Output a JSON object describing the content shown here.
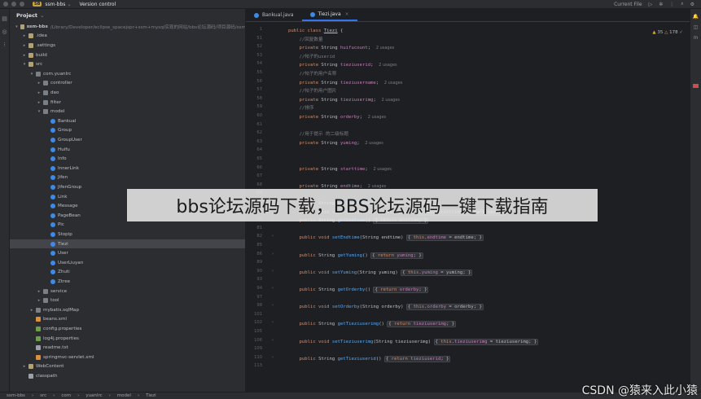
{
  "titlebar": {
    "project_badge": "SB",
    "project_name": "ssm-bbs",
    "vcs": "Version control",
    "run_config": "Current File"
  },
  "panel": {
    "title": "Project",
    "tree": [
      {
        "label": "ssm-bbs",
        "path": "/Library/Developer/eclipse_spacejspr+ssm+mysql实现的网站/bbs论坛源码/项目源码/ssm",
        "depth": 0,
        "arrow": "▾",
        "icon": "folder",
        "bold": true
      },
      {
        "label": ".idea",
        "depth": 1,
        "arrow": "▸",
        "icon": "folder"
      },
      {
        "label": ".settings",
        "depth": 1,
        "arrow": "▸",
        "icon": "folder"
      },
      {
        "label": "build",
        "depth": 1,
        "arrow": "▸",
        "icon": "folder"
      },
      {
        "label": "src",
        "depth": 1,
        "arrow": "▾",
        "icon": "folder"
      },
      {
        "label": "com.yuanlrc",
        "depth": 2,
        "arrow": "▾",
        "icon": "pkg"
      },
      {
        "label": "controller",
        "depth": 3,
        "arrow": "▸",
        "icon": "pkg"
      },
      {
        "label": "dao",
        "depth": 3,
        "arrow": "▸",
        "icon": "pkg"
      },
      {
        "label": "filter",
        "depth": 3,
        "arrow": "▸",
        "icon": "pkg"
      },
      {
        "label": "model",
        "depth": 3,
        "arrow": "▾",
        "icon": "pkg"
      },
      {
        "label": "Bankual",
        "depth": 4,
        "arrow": "",
        "icon": "cls"
      },
      {
        "label": "Group",
        "depth": 4,
        "arrow": "",
        "icon": "cls"
      },
      {
        "label": "GroupUser",
        "depth": 4,
        "arrow": "",
        "icon": "cls"
      },
      {
        "label": "Huifu",
        "depth": 4,
        "arrow": "",
        "icon": "cls"
      },
      {
        "label": "Info",
        "depth": 4,
        "arrow": "",
        "icon": "cls"
      },
      {
        "label": "InnerLink",
        "depth": 4,
        "arrow": "",
        "icon": "cls"
      },
      {
        "label": "Jifen",
        "depth": 4,
        "arrow": "",
        "icon": "cls"
      },
      {
        "label": "JifenGroup",
        "depth": 4,
        "arrow": "",
        "icon": "cls"
      },
      {
        "label": "Link",
        "depth": 4,
        "arrow": "",
        "icon": "cls"
      },
      {
        "label": "Message",
        "depth": 4,
        "arrow": "",
        "icon": "cls"
      },
      {
        "label": "PageBean",
        "depth": 4,
        "arrow": "",
        "icon": "cls"
      },
      {
        "label": "Pic",
        "depth": 4,
        "arrow": "",
        "icon": "cls"
      },
      {
        "label": "Stopip",
        "depth": 4,
        "arrow": "",
        "icon": "cls"
      },
      {
        "label": "Tiezi",
        "depth": 4,
        "arrow": "",
        "icon": "cls",
        "selected": true
      },
      {
        "label": "User",
        "depth": 4,
        "arrow": "",
        "icon": "cls"
      },
      {
        "label": "UserLiuyan",
        "depth": 4,
        "arrow": "",
        "icon": "cls"
      },
      {
        "label": "Zhuti",
        "depth": 4,
        "arrow": "",
        "icon": "cls"
      },
      {
        "label": "Ztree",
        "depth": 4,
        "arrow": "",
        "icon": "cls"
      },
      {
        "label": "service",
        "depth": 3,
        "arrow": "▸",
        "icon": "pkg"
      },
      {
        "label": "tool",
        "depth": 3,
        "arrow": "▸",
        "icon": "pkg"
      },
      {
        "label": "mybatis.sqlMap",
        "depth": 2,
        "arrow": "▸",
        "icon": "pkg"
      },
      {
        "label": "beans.xml",
        "depth": 2,
        "arrow": "",
        "icon": "xml"
      },
      {
        "label": "config.properties",
        "depth": 2,
        "arrow": "",
        "icon": "prop"
      },
      {
        "label": "log4j.properties",
        "depth": 2,
        "arrow": "",
        "icon": "prop"
      },
      {
        "label": "readme.txt",
        "depth": 2,
        "arrow": "",
        "icon": "file"
      },
      {
        "label": "springmvc-servlet.xml",
        "depth": 2,
        "arrow": "",
        "icon": "xml"
      },
      {
        "label": "WebContent",
        "depth": 1,
        "arrow": "▸",
        "icon": "folder"
      },
      {
        "label": "classpath",
        "depth": 1,
        "arrow": "",
        "icon": "file"
      }
    ]
  },
  "editor": {
    "tabs": [
      {
        "label": "Bankual.java",
        "active": false
      },
      {
        "label": "Tiezi.java",
        "active": true
      }
    ],
    "inspections": {
      "warnings": "35",
      "weak": "178"
    },
    "lines": [
      {
        "n": "1",
        "html": "<span class='k'>public class</span> <span style='text-decoration:underline'>Tiezi</span> {"
      },
      {
        "n": "51",
        "html": "    <span class='c'>//回复数量</span>"
      },
      {
        "n": "52",
        "html": "    <span class='k'>private</span> String <span class='f'>huifucount</span>;  <span class='h'>2 usages</span>"
      },
      {
        "n": "53",
        "html": "    <span class='c'>//帖子的userid</span>"
      },
      {
        "n": "54",
        "html": "    <span class='k'>private</span> String <span class='f'>tieziuserid</span>;  <span class='h'>2 usages</span>"
      },
      {
        "n": "55",
        "html": "    <span class='c'>//帖子的用户名称</span>"
      },
      {
        "n": "56",
        "html": "    <span class='k'>private</span> String <span class='f'>tieziusername</span>;  <span class='h'>2 usages</span>"
      },
      {
        "n": "57",
        "html": "    <span class='c'>//帖子的用户图片</span>"
      },
      {
        "n": "58",
        "html": "    <span class='k'>private</span> String <span class='f'>tieziuserimg</span>;  <span class='h'>2 usages</span>"
      },
      {
        "n": "59",
        "html": "    <span class='c'>//排序</span>"
      },
      {
        "n": "60",
        "html": "    <span class='k'>private</span> String <span class='f'>orderby</span>;  <span class='h'>2 usages</span>"
      },
      {
        "n": "61",
        "html": ""
      },
      {
        "n": "62",
        "html": "    <span class='c'>//用于提示 的二级标题</span>"
      },
      {
        "n": "63",
        "html": "    <span class='k'>private</span> String <span class='f'>yuming</span>;  <span class='h'>2 usages</span>"
      },
      {
        "n": "64",
        "html": ""
      },
      {
        "n": "65",
        "html": ""
      },
      {
        "n": "66",
        "html": "    <span class='k'>private</span> String <span class='f'>starttime</span>;  <span class='h'>2 usages</span>"
      },
      {
        "n": "67",
        "html": ""
      },
      {
        "n": "68",
        "html": "    <span class='k'>private</span> String <span class='f'>endtime</span>;  <span class='h'>2 usages</span>"
      },
      {
        "n": "69",
        "html": ""
      },
      {
        "n": "72",
        "html": "    <span class='k'>public</span> String <span class='m'>getStarttime</span>() <span class='fold'>{ <span class='k'>return</span> <span class='f'>starttime</span>; }</span>"
      },
      {
        "n": "75",
        "html": "    <span class='k'>public void</span> <span class='m'>setStarttime</span>(String starttime) <span class='fold'>{ <span class='k'>this</span>.<span class='f'>starttime</span> = starttime; }</span>"
      },
      {
        "n": "78",
        "html": "    <span class='k'>public</span> String <span class='m'>getEndtime</span>() <span class='fold'>{ <span class='k'>return</span> <span class='f'>endtime</span>; }</span>"
      },
      {
        "n": "81",
        "html": ""
      },
      {
        "n": "82",
        "html": "    <span class='k'>public void</span> <span class='m'>setEndtime</span>(String endtime) <span class='fold'>{ <span class='k'>this</span>.<span class='f'>endtime</span> = endtime; }</span>"
      },
      {
        "n": "85",
        "html": ""
      },
      {
        "n": "86",
        "html": "    <span class='k'>public</span> String <span class='m'>getYuming</span>() <span class='fold'>{ <span class='k'>return</span> <span class='f'>yuming</span>; }</span>"
      },
      {
        "n": "89",
        "html": ""
      },
      {
        "n": "90",
        "html": "    <span class='k'>public void</span> <span class='m'>setYuming</span>(String yuming) <span class='fold'>{ <span class='k'>this</span>.<span class='f'>yuming</span> = yuming; }</span>"
      },
      {
        "n": "93",
        "html": ""
      },
      {
        "n": "94",
        "html": "    <span class='k'>public</span> String <span class='m'>getOrderby</span>() <span class='fold'>{ <span class='k'>return</span> <span class='f'>orderby</span>; }</span>"
      },
      {
        "n": "97",
        "html": ""
      },
      {
        "n": "98",
        "html": "    <span class='k'>public void</span> <span class='m'>setOrderby</span>(String orderby) <span class='fold'>{ <span class='k'>this</span>.<span class='f'>orderby</span> = orderby; }</span>"
      },
      {
        "n": "101",
        "html": ""
      },
      {
        "n": "102",
        "html": "    <span class='k'>public</span> String <span class='m'>getTieziuserimg</span>() <span class='fold'>{ <span class='k'>return</span> <span class='f'>tieziuserimg</span>; }</span>"
      },
      {
        "n": "105",
        "html": ""
      },
      {
        "n": "106",
        "html": "    <span class='k'>public void</span> <span class='m'>setTieziuserimg</span>(String tieziuserimg) <span class='fold'>{ <span class='k'>this</span>.<span class='f'>tieziuserimg</span> = tieziuserimg; }</span>"
      },
      {
        "n": "109",
        "html": ""
      },
      {
        "n": "110",
        "html": "    <span class='k'>public</span> String <span class='m'>getTieziuserid</span>() <span class='fold'>{ <span class='k'>return</span> <span class='f'>tieziuserid</span>; }</span>"
      },
      {
        "n": "113",
        "html": ""
      }
    ]
  },
  "breadcrumb": [
    "ssm-bbs",
    "src",
    "com",
    "yuanlrc",
    "model",
    "Tiezi"
  ],
  "overlay_title": "bbs论坛源码下载，BBS论坛源码一键下载指南",
  "watermark": "CSDN @猿来入此小猿"
}
